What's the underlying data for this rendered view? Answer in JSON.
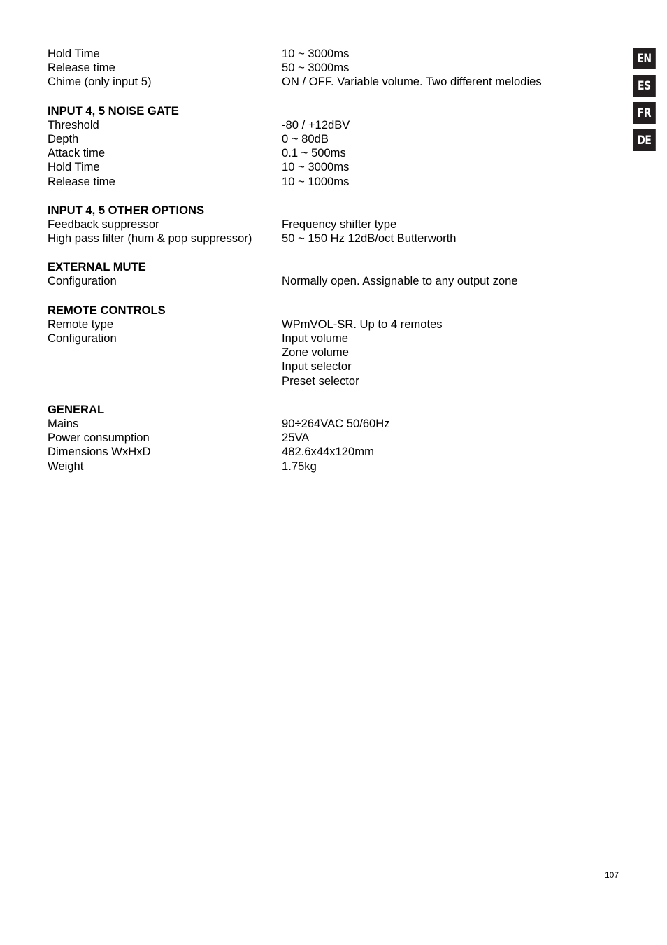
{
  "language_tabs": [
    "EN",
    "ES",
    "FR",
    "DE"
  ],
  "sections": [
    {
      "heading": "",
      "rows": [
        {
          "label": "Hold Time",
          "values": [
            "10 ~ 3000ms"
          ]
        },
        {
          "label": "Release time",
          "values": [
            "50 ~ 3000ms"
          ]
        },
        {
          "label": "Chime (only input 5)",
          "values": [
            "ON / OFF. Variable volume. Two different melodies"
          ]
        }
      ]
    },
    {
      "heading": "INPUT 4, 5 NOISE GATE",
      "rows": [
        {
          "label": "Threshold",
          "values": [
            "-80 / +12dBV"
          ]
        },
        {
          "label": "Depth",
          "values": [
            "0 ~ 80dB"
          ]
        },
        {
          "label": "Attack time",
          "values": [
            "0.1 ~ 500ms"
          ]
        },
        {
          "label": "Hold Time",
          "values": [
            "10 ~ 3000ms"
          ]
        },
        {
          "label": "Release time",
          "values": [
            "10 ~ 1000ms"
          ]
        }
      ]
    },
    {
      "heading": "INPUT 4, 5 OTHER OPTIONS",
      "rows": [
        {
          "label": "Feedback suppressor",
          "values": [
            "Frequency shifter type"
          ]
        },
        {
          "label": "High pass filter (hum & pop suppressor)",
          "values": [
            "50 ~ 150 Hz 12dB/oct Butterworth"
          ]
        }
      ]
    },
    {
      "heading": "EXTERNAL MUTE",
      "rows": [
        {
          "label": "Configuration",
          "values": [
            "Normally open. Assignable to any output zone"
          ]
        }
      ]
    },
    {
      "heading": "REMOTE CONTROLS",
      "rows": [
        {
          "label": "Remote type",
          "values": [
            "WPmVOL-SR. Up to 4 remotes"
          ]
        },
        {
          "label": "Configuration",
          "values": [
            "Input volume",
            "Zone volume",
            "Input selector",
            "Preset selector"
          ]
        }
      ]
    },
    {
      "heading": "GENERAL",
      "rows": [
        {
          "label": "Mains",
          "values": [
            "90÷264VAC 50/60Hz"
          ]
        },
        {
          "label": "Power consumption",
          "values": [
            "25VA"
          ]
        },
        {
          "label": "Dimensions WxHxD",
          "values": [
            "482.6x44x120mm"
          ]
        },
        {
          "label": "Weight",
          "values": [
            "1.75kg"
          ]
        }
      ]
    }
  ],
  "page_number": "107"
}
